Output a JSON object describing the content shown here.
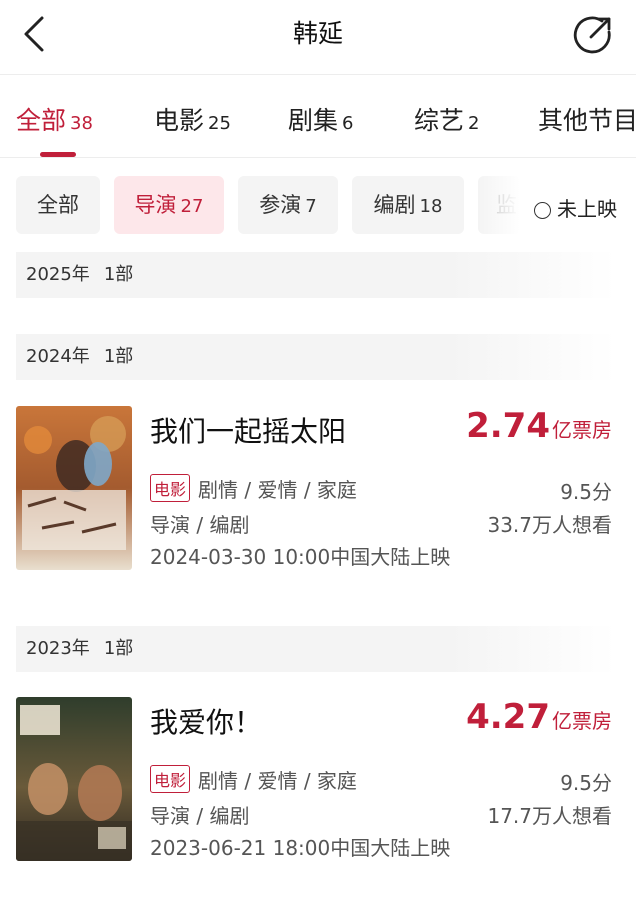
{
  "header": {
    "title": "韩延",
    "back_icon": "chevron-left-icon",
    "share_icon": "share-icon"
  },
  "tabs": [
    {
      "label": "全部",
      "count": "38",
      "active": true
    },
    {
      "label": "电影",
      "count": "25"
    },
    {
      "label": "剧集",
      "count": "6"
    },
    {
      "label": "综艺",
      "count": "2"
    },
    {
      "label": "其他节目",
      "count": ""
    }
  ],
  "roles": [
    {
      "label": "全部",
      "count": ""
    },
    {
      "label": "导演",
      "count": "27",
      "active": true
    },
    {
      "label": "参演",
      "count": "7"
    },
    {
      "label": "编剧",
      "count": "18"
    },
    {
      "label": "监",
      "count": ""
    }
  ],
  "filter": {
    "label": "未上映"
  },
  "years": [
    {
      "year": "2025年",
      "count": "1部"
    },
    {
      "year": "2024年",
      "count": "1部"
    },
    {
      "year": "2023年",
      "count": "1部"
    }
  ],
  "movies": [
    {
      "title": "我们一起摇太阳",
      "box_office_value": "2.74",
      "box_office_unit": "亿票房",
      "type_tag": "电影",
      "genres": "剧情 / 爱情 / 家庭",
      "rating": "9.5分",
      "roles": "导演 / 编剧",
      "want_to_see": "33.7万人想看",
      "release": "2024-03-30 10:00中国大陆上映"
    },
    {
      "title": "我爱你！",
      "box_office_value": "4.27",
      "box_office_unit": "亿票房",
      "type_tag": "电影",
      "genres": "剧情 / 爱情 / 家庭",
      "rating": "9.5分",
      "roles": "导演 / 编剧",
      "want_to_see": "17.7万人想看",
      "release": "2023-06-21 18:00中国大陆上映"
    }
  ],
  "colors": {
    "accent": "#c01f3a",
    "chip_bg": "#f4f4f4",
    "chip_active_bg": "#fde7ea"
  }
}
